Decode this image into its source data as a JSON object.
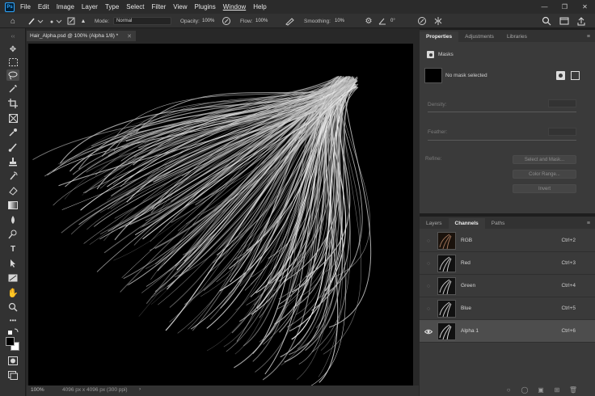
{
  "app": {
    "logo": "Ps"
  },
  "menu": [
    "File",
    "Edit",
    "Image",
    "Layer",
    "Type",
    "Select",
    "Filter",
    "View",
    "Plugins",
    "Window",
    "Help"
  ],
  "options_bar": {
    "mode_label": "Mode:",
    "mode_value": "Normal",
    "opacity_label": "Opacity:",
    "opacity_value": "100%",
    "flow_label": "Flow:",
    "flow_value": "100%",
    "smoothing_label": "Smoothing:",
    "smoothing_value": "10%",
    "angle_value": "0°"
  },
  "document": {
    "tab_title": "Hair_Alpha.psd @ 100% (Alpha 1/8) *",
    "zoom": "100%",
    "dimensions": "4096 px x 4096 px (300 ppi)"
  },
  "properties_panel": {
    "tabs": [
      "Properties",
      "Adjustments",
      "Libraries"
    ],
    "section": "Masks",
    "mask_status": "No mask selected",
    "density_label": "Density:",
    "feather_label": "Feather:",
    "refine_label": "Refine:",
    "select_and_mask": "Select and Mask...",
    "color_range": "Color Range...",
    "invert": "Invert"
  },
  "channels_panel": {
    "tabs": [
      "Layers",
      "Channels",
      "Paths"
    ],
    "channels": [
      {
        "name": "RGB",
        "shortcut": "Ctrl+2",
        "visible": false,
        "selected": false
      },
      {
        "name": "Red",
        "shortcut": "Ctrl+3",
        "visible": false,
        "selected": false
      },
      {
        "name": "Green",
        "shortcut": "Ctrl+4",
        "visible": false,
        "selected": false
      },
      {
        "name": "Blue",
        "shortcut": "Ctrl+5",
        "visible": false,
        "selected": false
      },
      {
        "name": "Alpha 1",
        "shortcut": "Ctrl+6",
        "visible": true,
        "selected": true
      }
    ]
  },
  "colors": {
    "accent": "#31a8ff",
    "panel": "#3a3a3a",
    "canvas": "#000000"
  }
}
